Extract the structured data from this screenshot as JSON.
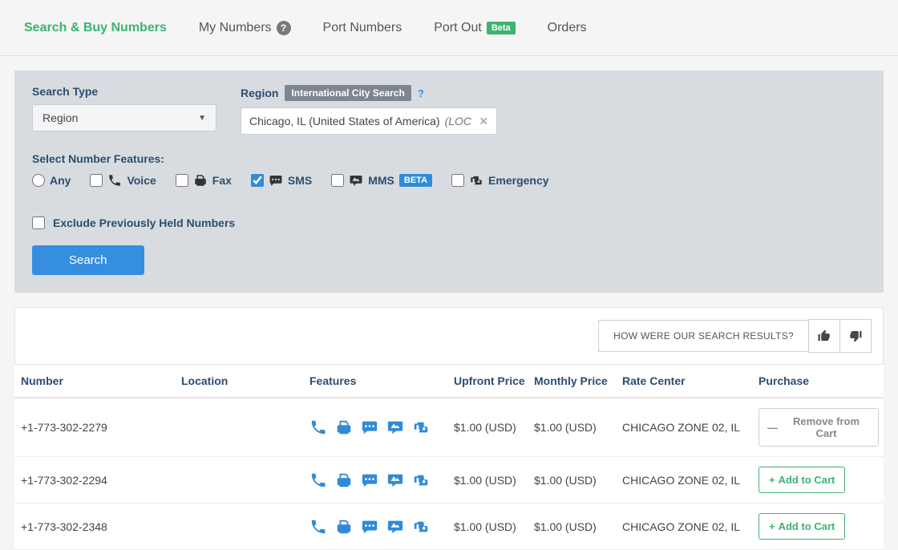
{
  "tabs": {
    "search_buy": "Search & Buy Numbers",
    "my_numbers": "My Numbers",
    "port_numbers": "Port Numbers",
    "port_out": "Port Out",
    "port_out_badge": "Beta",
    "orders": "Orders"
  },
  "search": {
    "type_label": "Search Type",
    "type_value": "Region",
    "region_label": "Region",
    "region_badge": "International City Search",
    "region_value": "Chicago, IL (United States of America)",
    "region_suffix": "(LOC",
    "features_label": "Select Number Features:",
    "features": {
      "any": "Any",
      "voice": "Voice",
      "fax": "Fax",
      "sms": "SMS",
      "mms": "MMS",
      "mms_badge": "BETA",
      "emergency": "Emergency"
    },
    "exclude_label": "Exclude Previously Held Numbers",
    "button": "Search"
  },
  "feedback": {
    "prompt": "HOW WERE OUR SEARCH RESULTS?"
  },
  "columns": {
    "number": "Number",
    "location": "Location",
    "features": "Features",
    "upfront": "Upfront Price",
    "monthly": "Monthly Price",
    "rate_center": "Rate Center",
    "purchase": "Purchase"
  },
  "buttons": {
    "remove": "Remove from Cart",
    "add": "Add to Cart"
  },
  "rows": [
    {
      "number": "+1-773-302-2279",
      "location": "",
      "upfront": "$1.00 (USD)",
      "monthly": "$1.00 (USD)",
      "rate_center": "CHICAGO ZONE 02, IL",
      "in_cart": true
    },
    {
      "number": "+1-773-302-2294",
      "location": "",
      "upfront": "$1.00 (USD)",
      "monthly": "$1.00 (USD)",
      "rate_center": "CHICAGO ZONE 02, IL",
      "in_cart": false
    },
    {
      "number": "+1-773-302-2348",
      "location": "",
      "upfront": "$1.00 (USD)",
      "monthly": "$1.00 (USD)",
      "rate_center": "CHICAGO ZONE 02, IL",
      "in_cart": false
    }
  ]
}
